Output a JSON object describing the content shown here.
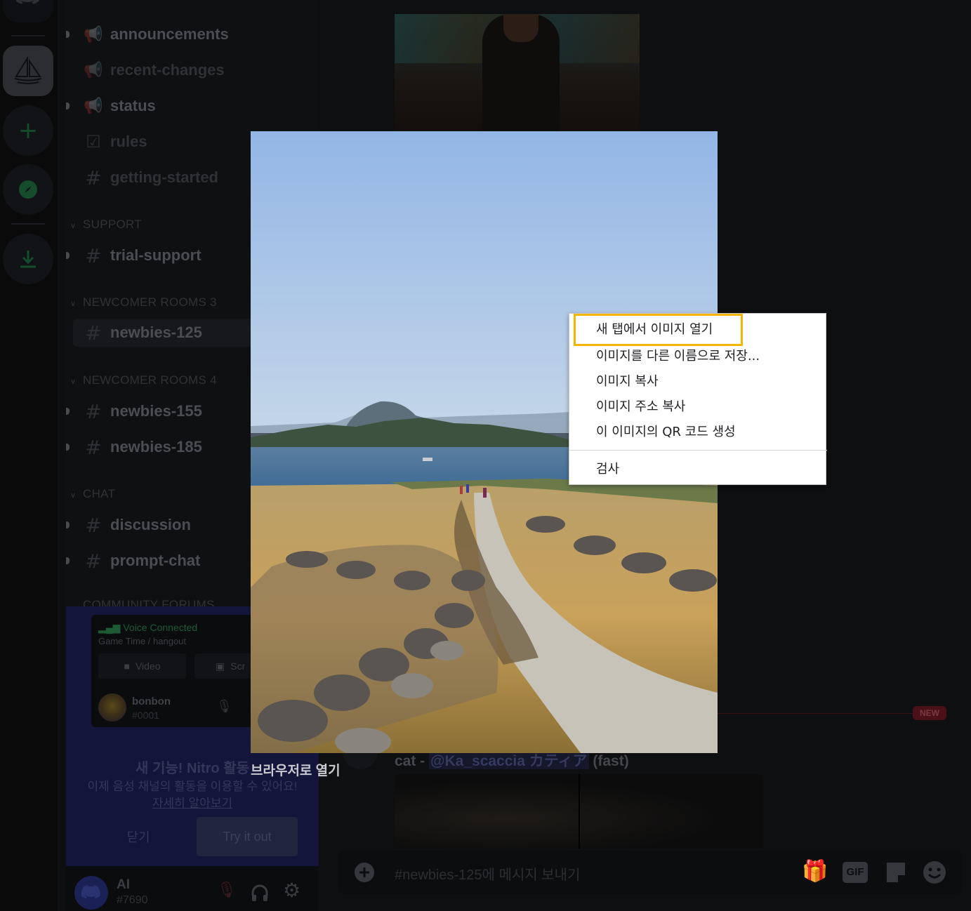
{
  "channels": [
    {
      "id": "announcements",
      "label": "announcements",
      "icon": "megaphone-icon",
      "glyph": "📢"
    },
    {
      "id": "recent-changes",
      "label": "recent-changes",
      "icon": "megaphone-icon",
      "glyph": "📢"
    },
    {
      "id": "status",
      "label": "status",
      "icon": "megaphone-icon",
      "glyph": "📢"
    },
    {
      "id": "rules",
      "label": "rules",
      "icon": "checkbox-icon",
      "glyph": "☑"
    },
    {
      "id": "getting-started",
      "label": "getting-started",
      "icon": "hash-icon",
      "glyph": "#"
    },
    {
      "id": "trial-support",
      "label": "trial-support",
      "icon": "hash-icon",
      "glyph": "#"
    },
    {
      "id": "newbies-125",
      "label": "newbies-125",
      "icon": "hash-thread-icon",
      "glyph": "#"
    },
    {
      "id": "newbies-155",
      "label": "newbies-155",
      "icon": "hash-thread-icon",
      "glyph": "#"
    },
    {
      "id": "newbies-185",
      "label": "newbies-185",
      "icon": "hash-thread-icon",
      "glyph": "#"
    },
    {
      "id": "discussion",
      "label": "discussion",
      "icon": "hash-icon",
      "glyph": "#"
    },
    {
      "id": "prompt-chat",
      "label": "prompt-chat",
      "icon": "hash-icon",
      "glyph": "#"
    }
  ],
  "categories": {
    "support": "SUPPORT",
    "newcomer3": "NEWCOMER ROOMS 3",
    "newcomer4": "NEWCOMER ROOMS 4",
    "chat": "CHAT",
    "forums": "COMMUNITY FORUMS"
  },
  "voice": {
    "status": "Voice Connected",
    "location": "Game Time / hangout",
    "video_label": "Video",
    "screen_label": "Scr",
    "user_name": "bonbon",
    "user_tag": "#0001"
  },
  "nitro": {
    "title": "새 기능! Nitro 활동",
    "description": "이제 음성 채널의 활동을 이용할 수 있어요!",
    "learn_more": "자세히 알아보기",
    "close_label": "닫기",
    "try_label": "Try it out"
  },
  "user": {
    "name": "AI",
    "tag": "#7690"
  },
  "chat": {
    "new_badge": "NEW",
    "author": "cat - ",
    "mention": "@Ka_scaccia カティア",
    "speed": " (fast)",
    "composer_placeholder": "#newbies-125에 메시지 보내기",
    "gif_label": "GIF"
  },
  "viewer": {
    "open_in_browser": "브라우저로 열기"
  },
  "context_menu": {
    "items": [
      {
        "label": "새 탭에서 이미지 열기",
        "highlighted": true
      },
      {
        "label": "이미지를 다른 이름으로 저장..."
      },
      {
        "label": "이미지 복사"
      },
      {
        "label": "이미지 주소 복사"
      },
      {
        "label": "이 이미지의 QR 코드 생성"
      }
    ],
    "inspect": "검사"
  },
  "colors": {
    "highlight": "#f2b705",
    "nitro_bg": "#13163a",
    "green": "#23a55a"
  }
}
